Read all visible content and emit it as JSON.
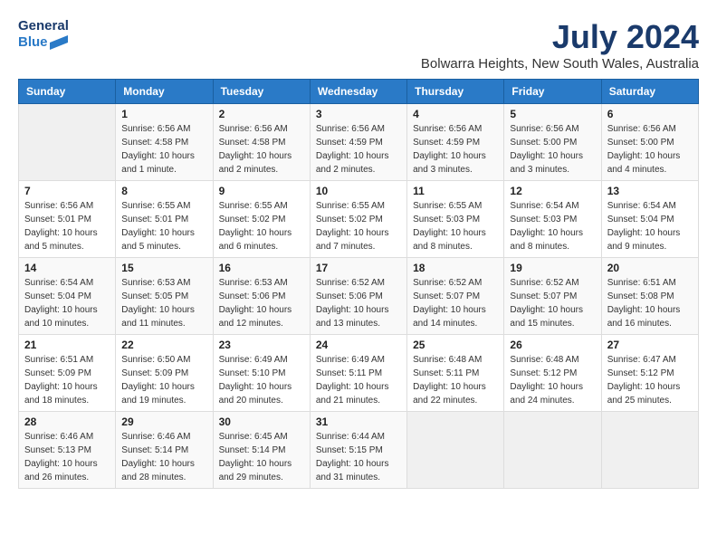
{
  "header": {
    "logo_line1": "General",
    "logo_line2": "Blue",
    "month": "July 2024",
    "location": "Bolwarra Heights, New South Wales, Australia"
  },
  "weekdays": [
    "Sunday",
    "Monday",
    "Tuesday",
    "Wednesday",
    "Thursday",
    "Friday",
    "Saturday"
  ],
  "weeks": [
    [
      {
        "day": "",
        "sunrise": "",
        "sunset": "",
        "daylight": ""
      },
      {
        "day": "1",
        "sunrise": "Sunrise: 6:56 AM",
        "sunset": "Sunset: 4:58 PM",
        "daylight": "Daylight: 10 hours and 1 minute."
      },
      {
        "day": "2",
        "sunrise": "Sunrise: 6:56 AM",
        "sunset": "Sunset: 4:58 PM",
        "daylight": "Daylight: 10 hours and 2 minutes."
      },
      {
        "day": "3",
        "sunrise": "Sunrise: 6:56 AM",
        "sunset": "Sunset: 4:59 PM",
        "daylight": "Daylight: 10 hours and 2 minutes."
      },
      {
        "day": "4",
        "sunrise": "Sunrise: 6:56 AM",
        "sunset": "Sunset: 4:59 PM",
        "daylight": "Daylight: 10 hours and 3 minutes."
      },
      {
        "day": "5",
        "sunrise": "Sunrise: 6:56 AM",
        "sunset": "Sunset: 5:00 PM",
        "daylight": "Daylight: 10 hours and 3 minutes."
      },
      {
        "day": "6",
        "sunrise": "Sunrise: 6:56 AM",
        "sunset": "Sunset: 5:00 PM",
        "daylight": "Daylight: 10 hours and 4 minutes."
      }
    ],
    [
      {
        "day": "7",
        "sunrise": "Sunrise: 6:56 AM",
        "sunset": "Sunset: 5:01 PM",
        "daylight": "Daylight: 10 hours and 5 minutes."
      },
      {
        "day": "8",
        "sunrise": "Sunrise: 6:55 AM",
        "sunset": "Sunset: 5:01 PM",
        "daylight": "Daylight: 10 hours and 5 minutes."
      },
      {
        "day": "9",
        "sunrise": "Sunrise: 6:55 AM",
        "sunset": "Sunset: 5:02 PM",
        "daylight": "Daylight: 10 hours and 6 minutes."
      },
      {
        "day": "10",
        "sunrise": "Sunrise: 6:55 AM",
        "sunset": "Sunset: 5:02 PM",
        "daylight": "Daylight: 10 hours and 7 minutes."
      },
      {
        "day": "11",
        "sunrise": "Sunrise: 6:55 AM",
        "sunset": "Sunset: 5:03 PM",
        "daylight": "Daylight: 10 hours and 8 minutes."
      },
      {
        "day": "12",
        "sunrise": "Sunrise: 6:54 AM",
        "sunset": "Sunset: 5:03 PM",
        "daylight": "Daylight: 10 hours and 8 minutes."
      },
      {
        "day": "13",
        "sunrise": "Sunrise: 6:54 AM",
        "sunset": "Sunset: 5:04 PM",
        "daylight": "Daylight: 10 hours and 9 minutes."
      }
    ],
    [
      {
        "day": "14",
        "sunrise": "Sunrise: 6:54 AM",
        "sunset": "Sunset: 5:04 PM",
        "daylight": "Daylight: 10 hours and 10 minutes."
      },
      {
        "day": "15",
        "sunrise": "Sunrise: 6:53 AM",
        "sunset": "Sunset: 5:05 PM",
        "daylight": "Daylight: 10 hours and 11 minutes."
      },
      {
        "day": "16",
        "sunrise": "Sunrise: 6:53 AM",
        "sunset": "Sunset: 5:06 PM",
        "daylight": "Daylight: 10 hours and 12 minutes."
      },
      {
        "day": "17",
        "sunrise": "Sunrise: 6:52 AM",
        "sunset": "Sunset: 5:06 PM",
        "daylight": "Daylight: 10 hours and 13 minutes."
      },
      {
        "day": "18",
        "sunrise": "Sunrise: 6:52 AM",
        "sunset": "Sunset: 5:07 PM",
        "daylight": "Daylight: 10 hours and 14 minutes."
      },
      {
        "day": "19",
        "sunrise": "Sunrise: 6:52 AM",
        "sunset": "Sunset: 5:07 PM",
        "daylight": "Daylight: 10 hours and 15 minutes."
      },
      {
        "day": "20",
        "sunrise": "Sunrise: 6:51 AM",
        "sunset": "Sunset: 5:08 PM",
        "daylight": "Daylight: 10 hours and 16 minutes."
      }
    ],
    [
      {
        "day": "21",
        "sunrise": "Sunrise: 6:51 AM",
        "sunset": "Sunset: 5:09 PM",
        "daylight": "Daylight: 10 hours and 18 minutes."
      },
      {
        "day": "22",
        "sunrise": "Sunrise: 6:50 AM",
        "sunset": "Sunset: 5:09 PM",
        "daylight": "Daylight: 10 hours and 19 minutes."
      },
      {
        "day": "23",
        "sunrise": "Sunrise: 6:49 AM",
        "sunset": "Sunset: 5:10 PM",
        "daylight": "Daylight: 10 hours and 20 minutes."
      },
      {
        "day": "24",
        "sunrise": "Sunrise: 6:49 AM",
        "sunset": "Sunset: 5:11 PM",
        "daylight": "Daylight: 10 hours and 21 minutes."
      },
      {
        "day": "25",
        "sunrise": "Sunrise: 6:48 AM",
        "sunset": "Sunset: 5:11 PM",
        "daylight": "Daylight: 10 hours and 22 minutes."
      },
      {
        "day": "26",
        "sunrise": "Sunrise: 6:48 AM",
        "sunset": "Sunset: 5:12 PM",
        "daylight": "Daylight: 10 hours and 24 minutes."
      },
      {
        "day": "27",
        "sunrise": "Sunrise: 6:47 AM",
        "sunset": "Sunset: 5:12 PM",
        "daylight": "Daylight: 10 hours and 25 minutes."
      }
    ],
    [
      {
        "day": "28",
        "sunrise": "Sunrise: 6:46 AM",
        "sunset": "Sunset: 5:13 PM",
        "daylight": "Daylight: 10 hours and 26 minutes."
      },
      {
        "day": "29",
        "sunrise": "Sunrise: 6:46 AM",
        "sunset": "Sunset: 5:14 PM",
        "daylight": "Daylight: 10 hours and 28 minutes."
      },
      {
        "day": "30",
        "sunrise": "Sunrise: 6:45 AM",
        "sunset": "Sunset: 5:14 PM",
        "daylight": "Daylight: 10 hours and 29 minutes."
      },
      {
        "day": "31",
        "sunrise": "Sunrise: 6:44 AM",
        "sunset": "Sunset: 5:15 PM",
        "daylight": "Daylight: 10 hours and 31 minutes."
      },
      {
        "day": "",
        "sunrise": "",
        "sunset": "",
        "daylight": ""
      },
      {
        "day": "",
        "sunrise": "",
        "sunset": "",
        "daylight": ""
      },
      {
        "day": "",
        "sunrise": "",
        "sunset": "",
        "daylight": ""
      }
    ]
  ]
}
